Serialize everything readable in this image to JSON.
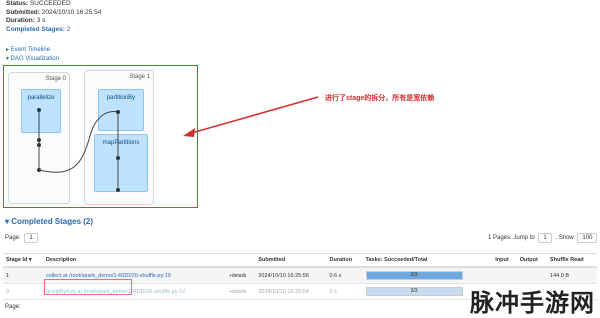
{
  "summary": {
    "status_key": "Status:",
    "status_val": "SUCCEEDED",
    "submitted_key": "Submitted:",
    "submitted_val": "2024/10/10 16:25:54",
    "duration_key": "Duration:",
    "duration_val": "3 s",
    "completed_key": "Completed Stages:",
    "completed_val": "2"
  },
  "toggles": {
    "event_timeline": "▸ Event Timeline",
    "dag_visualization": "▾ DAG Visualization"
  },
  "dag": {
    "stage0": {
      "label": "Stage 0",
      "rdd": "parallelize"
    },
    "stage1": {
      "label": "Stage 1",
      "rdd1": "partitionBy",
      "rdd2": "mapPartitions"
    }
  },
  "annotation": "进行了stage的拆分，所有是宽依赖",
  "completed_stages": {
    "title": "▾ Completed Stages (2)",
    "page_label": "Page:",
    "page_num": "1",
    "pages_text": "1 Pages. Jump to",
    "jump_val": "1",
    "show_label": ". Show",
    "show_val": "100",
    "headers": [
      "Stage Id ▾",
      "Description",
      "Submitted",
      "Duration",
      "Tasks: Succeeded/Total",
      "Input",
      "Output",
      "Shuffle Read"
    ],
    "rows": [
      {
        "id": "1",
        "desc": "collect at /root/spark_demo/1-RDD/20-shuffle.py:19",
        "details": "+details",
        "submitted": "2024/10/10 16:25:56",
        "duration": "0.6 s",
        "tasks": "3/3",
        "progress": 1.0,
        "input": "",
        "output": "",
        "shuffle": "144.0 B"
      },
      {
        "id": "0",
        "desc": "groupByKey at /root/spark_demo/1-RDD/20-shuffle.py:12",
        "details": "+details",
        "submitted": "2024/10/10 16:25:54",
        "duration": "2 s",
        "tasks": "3/3",
        "progress": 1.0,
        "input": "",
        "output": "",
        "shuffle": ""
      }
    ],
    "footer_page": "Page:"
  },
  "watermark": "脉冲手游网",
  "colors": {
    "accent": "#2a6bb3",
    "annotation": "#d32f2f",
    "rdd_fill": "#bfe2ff"
  }
}
